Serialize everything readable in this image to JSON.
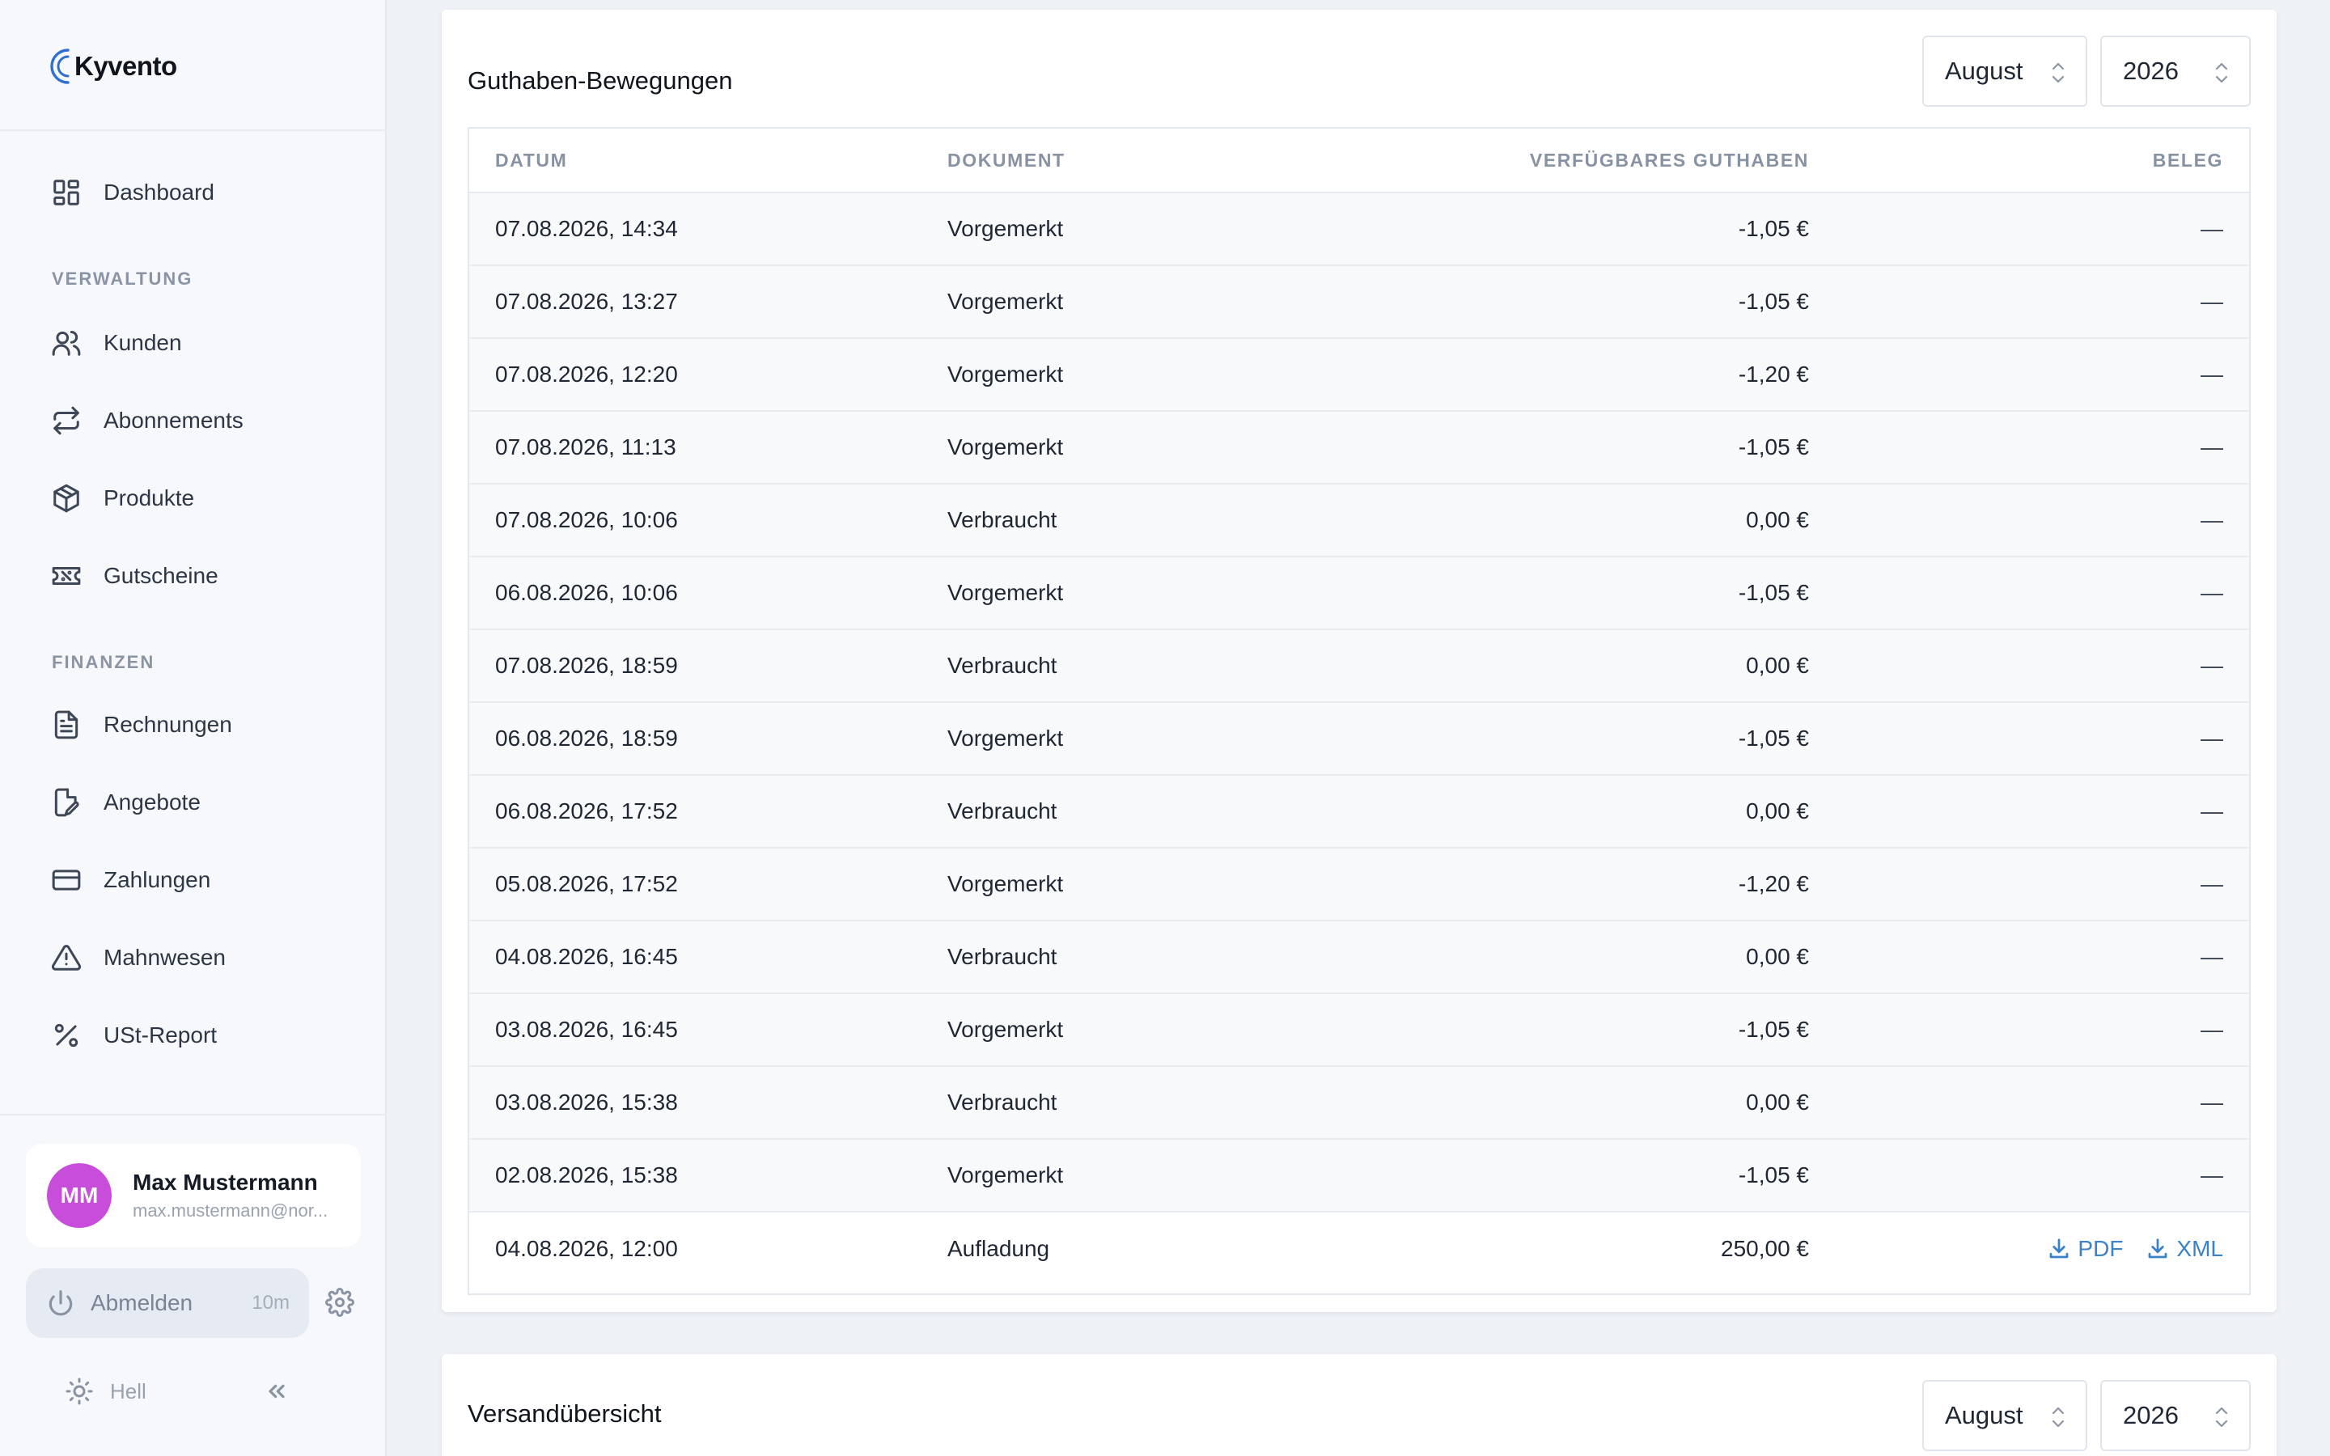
{
  "brand": {
    "name": "Kyvento"
  },
  "nav": {
    "dashboard": "Dashboard",
    "section_verwaltung": "VERWALTUNG",
    "kunden": "Kunden",
    "abonnements": "Abonnements",
    "produkte": "Produkte",
    "gutscheine": "Gutscheine",
    "section_finanzen": "FINANZEN",
    "rechnungen": "Rechnungen",
    "angebote": "Angebote",
    "zahlungen": "Zahlungen",
    "mahnwesen": "Mahnwesen",
    "ust_report": "USt-Report"
  },
  "user": {
    "initials": "MM",
    "name": "Max Mustermann",
    "email": "max.mustermann@nor..."
  },
  "logout": {
    "label": "Abmelden",
    "timer": "10m"
  },
  "theme": {
    "label": "Hell"
  },
  "movements": {
    "title": "Guthaben-Bewegungen",
    "month": "August",
    "year": "2026",
    "columns": {
      "date": "DATUM",
      "document": "DOKUMENT",
      "balance": "VERFÜGBARES GUTHABEN",
      "receipt": "BELEG"
    },
    "rows": [
      {
        "date": "07.08.2026, 14:34",
        "document": "Vorgemerkt",
        "amount": "-1,05 €",
        "receipt": "—"
      },
      {
        "date": "07.08.2026, 13:27",
        "document": "Vorgemerkt",
        "amount": "-1,05 €",
        "receipt": "—"
      },
      {
        "date": "07.08.2026, 12:20",
        "document": "Vorgemerkt",
        "amount": "-1,20 €",
        "receipt": "—"
      },
      {
        "date": "07.08.2026, 11:13",
        "document": "Vorgemerkt",
        "amount": "-1,05 €",
        "receipt": "—"
      },
      {
        "date": "07.08.2026, 10:06",
        "document": "Verbraucht",
        "amount": "0,00 €",
        "receipt": "—"
      },
      {
        "date": "06.08.2026, 10:06",
        "document": "Vorgemerkt",
        "amount": "-1,05 €",
        "receipt": "—"
      },
      {
        "date": "07.08.2026, 18:59",
        "document": "Verbraucht",
        "amount": "0,00 €",
        "receipt": "—"
      },
      {
        "date": "06.08.2026, 18:59",
        "document": "Vorgemerkt",
        "amount": "-1,05 €",
        "receipt": "—"
      },
      {
        "date": "06.08.2026, 17:52",
        "document": "Verbraucht",
        "amount": "0,00 €",
        "receipt": "—"
      },
      {
        "date": "05.08.2026, 17:52",
        "document": "Vorgemerkt",
        "amount": "-1,20 €",
        "receipt": "—"
      },
      {
        "date": "04.08.2026, 16:45",
        "document": "Verbraucht",
        "amount": "0,00 €",
        "receipt": "—"
      },
      {
        "date": "03.08.2026, 16:45",
        "document": "Vorgemerkt",
        "amount": "-1,05 €",
        "receipt": "—"
      },
      {
        "date": "03.08.2026, 15:38",
        "document": "Verbraucht",
        "amount": "0,00 €",
        "receipt": "—"
      },
      {
        "date": "02.08.2026, 15:38",
        "document": "Vorgemerkt",
        "amount": "-1,05 €",
        "receipt": "—"
      }
    ],
    "last_row": {
      "date": "04.08.2026, 12:00",
      "document": "Aufladung",
      "amount": "250,00 €",
      "pdf": "PDF",
      "xml": "XML"
    }
  },
  "shipping": {
    "title": "Versandübersicht",
    "month": "August",
    "year": "2026"
  },
  "colors": {
    "accent": "#3b82c8",
    "avatar": "#c84ddb"
  }
}
